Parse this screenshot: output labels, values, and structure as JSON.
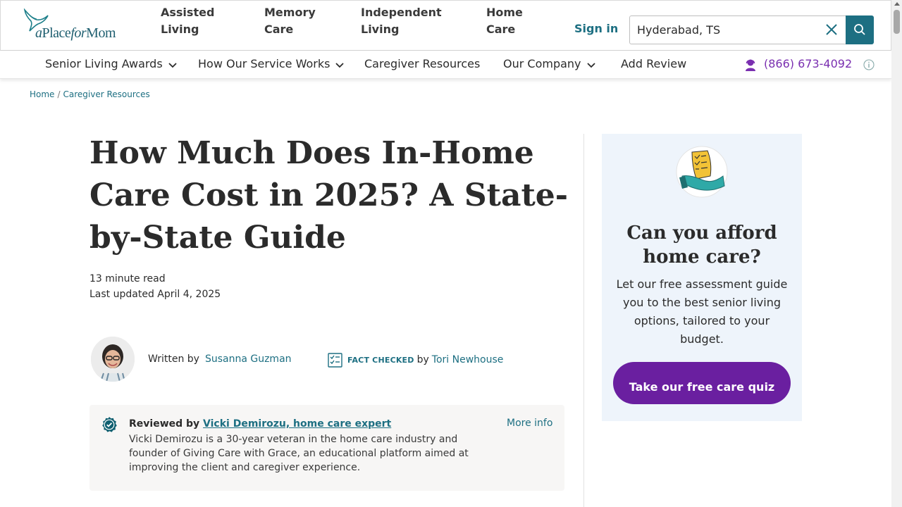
{
  "header": {
    "logo_text_a": "a",
    "logo_text_place": "Place",
    "logo_text_for": "for",
    "logo_text_mom": "Mom",
    "nav": [
      {
        "line1": "Assisted",
        "line2": "Living"
      },
      {
        "line1": "Memory",
        "line2": "Care"
      },
      {
        "line1": "Independent",
        "line2": "Living"
      },
      {
        "line1": "Home",
        "line2": "Care"
      }
    ],
    "signin_label": "Sign in",
    "search_value": "Hyderabad, TS"
  },
  "subnav": {
    "items": [
      {
        "label": "Senior Living Awards",
        "has_dropdown": true
      },
      {
        "label": "How Our Service Works",
        "has_dropdown": true
      },
      {
        "label": "Caregiver Resources",
        "has_dropdown": false
      },
      {
        "label": "Our Company",
        "has_dropdown": true
      },
      {
        "label": "Add Review",
        "has_dropdown": false
      }
    ],
    "phone": "(866) 673-4092",
    "phone_color": "#7a2fb0"
  },
  "breadcrumb": {
    "items": [
      "Home",
      "Caregiver Resources"
    ],
    "separator": "/"
  },
  "article": {
    "title": "How Much Does In-Home Care Cost in 2025? A State-by-State Guide",
    "read_time": "13 minute read",
    "last_updated": "Last updated April 4, 2025",
    "written_by_label": "Written by",
    "author": "Susanna Guzman",
    "fact_checked_label": "FACT CHECKED",
    "fact_checked_by": "by",
    "fact_checker": "Tori Newhouse",
    "review": {
      "label": "Reviewed by",
      "reviewer": "Vicki Demirozu, home care expert",
      "more_info": "More info",
      "body": "Vicki Demirozu is a 30-year veteran in the home care industry and founder of Giving Care with Grace, an educational platform aimed at improving the client and caregiver experience."
    }
  },
  "sidebar": {
    "title": "Can you afford home care?",
    "text": "Let our free assessment guide you to the best senior living options, tailored to your budget.",
    "cta_label": "Take our free care quiz",
    "cta_color": "#6a1fa0",
    "card_bg": "#eef4fb"
  },
  "colors": {
    "brand_teal": "#1d6f82",
    "text": "#2b2b2b"
  }
}
